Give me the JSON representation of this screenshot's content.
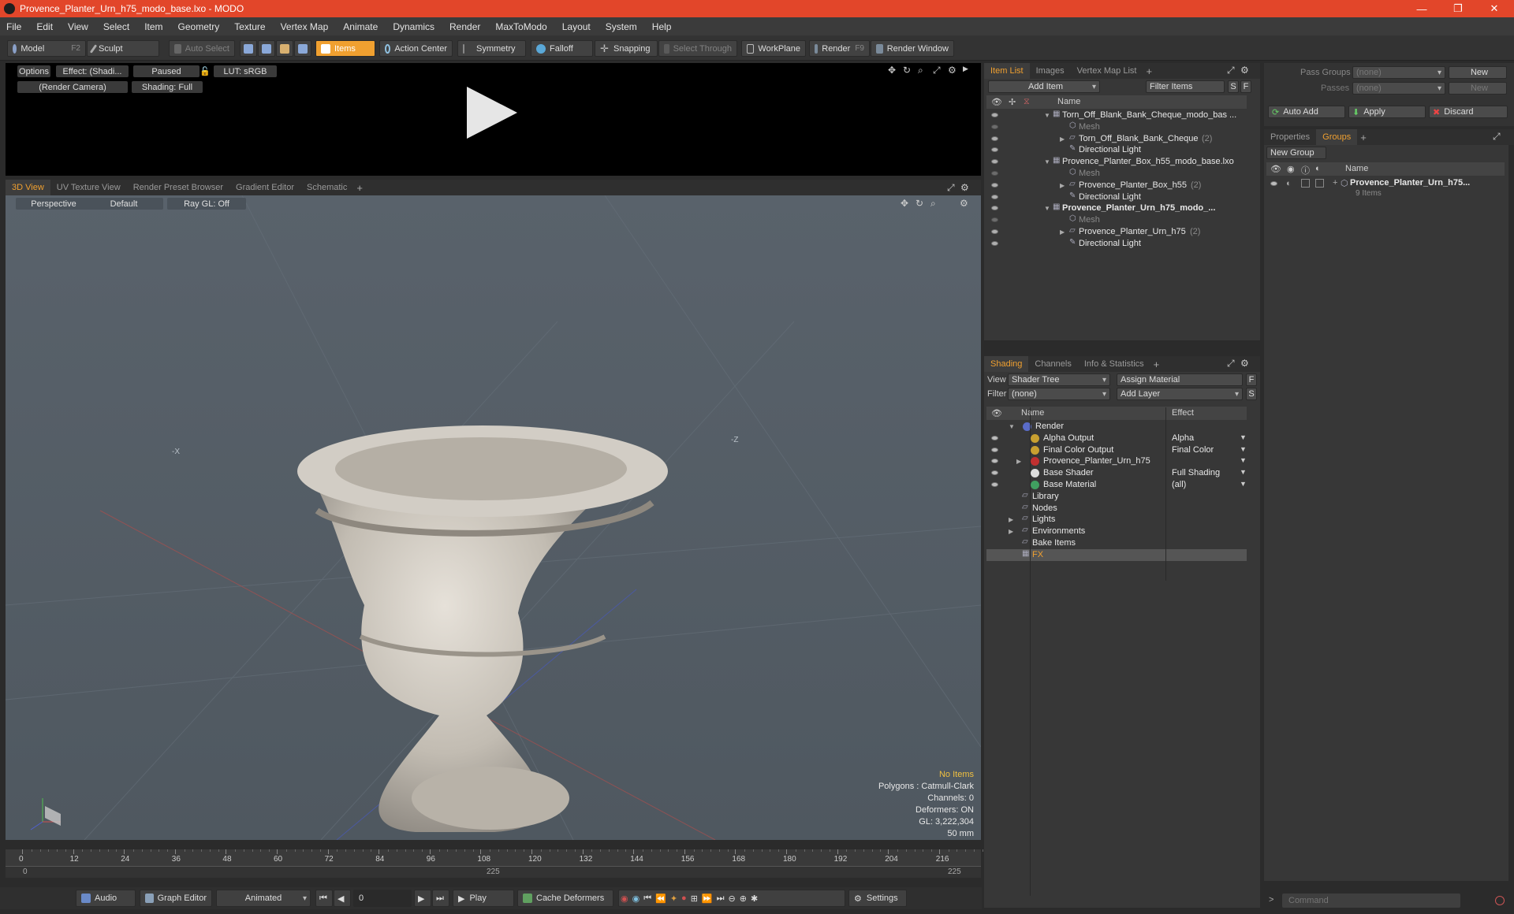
{
  "window": {
    "title": "Provence_Planter_Urn_h75_modo_base.lxo - MODO",
    "minimize": "—",
    "restore": "❐",
    "close": "✕"
  },
  "menu": [
    "File",
    "Edit",
    "View",
    "Select",
    "Item",
    "Geometry",
    "Texture",
    "Vertex Map",
    "Animate",
    "Dynamics",
    "Render",
    "MaxToModo",
    "Layout",
    "System",
    "Help"
  ],
  "toolbar": {
    "model": "Model",
    "model_key": "F2",
    "sculpt": "Sculpt",
    "auto_select": "Auto Select",
    "items": "Items",
    "action_center": "Action Center",
    "symmetry": "Symmetry",
    "falloff": "Falloff",
    "snapping": "Snapping",
    "select_through": "Select Through",
    "workplane": "WorkPlane",
    "render": "Render",
    "render_key": "F9",
    "render_window": "Render Window"
  },
  "preview": {
    "options": "Options",
    "effect": "Effect: (Shadi...",
    "paused": "Paused",
    "lut": "LUT: sRGB",
    "camera": "(Render Camera)",
    "shading": "Shading: Full"
  },
  "viewport_tabs": [
    "3D View",
    "UV Texture View",
    "Render Preset Browser",
    "Gradient Editor",
    "Schematic",
    "+"
  ],
  "viewport": {
    "projection": "Perspective",
    "style": "Default",
    "raygl": "Ray GL: Off",
    "axis_x": "-X",
    "axis_z": "-Z",
    "info": {
      "items": "No Items",
      "polygons": "Polygons : Catmull-Clark",
      "channels": "Channels: 0",
      "deformers": "Deformers: ON",
      "gl": "GL: 3,222,304",
      "size": "50 mm"
    }
  },
  "timeline": {
    "ticks": [
      "0",
      "12",
      "24",
      "36",
      "48",
      "60",
      "72",
      "84",
      "96",
      "108",
      "120",
      "132",
      "144",
      "156",
      "168",
      "180",
      "192",
      "204",
      "216"
    ],
    "start": "0",
    "mid": "225",
    "end": "225"
  },
  "bottom": {
    "audio": "Audio",
    "graph_editor": "Graph Editor",
    "animated": "Animated",
    "frame": "0",
    "play": "Play",
    "cache_deformers": "Cache Deformers",
    "settings": "Settings"
  },
  "item_list": {
    "tabs": [
      "Item List",
      "Images",
      "Vertex Map List",
      "+"
    ],
    "add_item": "Add Item",
    "filter_items": "Filter Items",
    "s": "S",
    "f": "F",
    "name_header": "Name",
    "rows": [
      {
        "label": "Torn_Off_Blank_Bank_Cheque_modo_bas ...",
        "count": "",
        "indent": 0,
        "type": "scene",
        "bold": false
      },
      {
        "label": "Mesh",
        "count": "",
        "indent": 1,
        "type": "mesh",
        "bold": false
      },
      {
        "label": "Torn_Off_Blank_Bank_Cheque",
        "count": "(2)",
        "indent": 1,
        "type": "group",
        "bold": false
      },
      {
        "label": "Directional Light",
        "count": "",
        "indent": 1,
        "type": "light",
        "bold": false
      },
      {
        "label": "Provence_Planter_Box_h55_modo_base.lxo",
        "count": "",
        "indent": 0,
        "type": "scene",
        "bold": false
      },
      {
        "label": "Mesh",
        "count": "",
        "indent": 1,
        "type": "mesh",
        "bold": false
      },
      {
        "label": "Provence_Planter_Box_h55",
        "count": "(2)",
        "indent": 1,
        "type": "group",
        "bold": false
      },
      {
        "label": "Directional Light",
        "count": "",
        "indent": 1,
        "type": "light",
        "bold": false
      },
      {
        "label": "Provence_Planter_Urn_h75_modo_...",
        "count": "",
        "indent": 0,
        "type": "scene",
        "bold": true
      },
      {
        "label": "Mesh",
        "count": "",
        "indent": 1,
        "type": "mesh",
        "bold": false
      },
      {
        "label": "Provence_Planter_Urn_h75",
        "count": "(2)",
        "indent": 1,
        "type": "group",
        "bold": false
      },
      {
        "label": "Directional Light",
        "count": "",
        "indent": 1,
        "type": "light",
        "bold": false
      }
    ]
  },
  "shading": {
    "tabs": [
      "Shading",
      "Channels",
      "Info & Statistics",
      "+"
    ],
    "view_label": "View",
    "view_value": "Shader Tree",
    "assign_material": "Assign Material",
    "filter_label": "Filter",
    "filter_value": "(none)",
    "add_layer": "Add Layer",
    "f": "F",
    "s": "S",
    "name_header": "Name",
    "effect_header": "Effect",
    "rows": [
      {
        "label": "Render",
        "effect": "",
        "indent": 0,
        "icon": "#5a6cc8",
        "eye": false,
        "fx": false
      },
      {
        "label": "Alpha Output",
        "effect": "Alpha",
        "indent": 1,
        "icon": "#c8a030",
        "eye": true,
        "fx": false
      },
      {
        "label": "Final Color Output",
        "effect": "Final Color",
        "indent": 1,
        "icon": "#c8a030",
        "eye": true,
        "fx": false
      },
      {
        "label": "Provence_Planter_Urn_h75",
        "effect": "",
        "indent": 1,
        "icon": "#c03030",
        "eye": true,
        "fx": false
      },
      {
        "label": "Base Shader",
        "effect": "Full Shading",
        "indent": 1,
        "icon": "#dddddd",
        "eye": true,
        "fx": false
      },
      {
        "label": "Base Material",
        "effect": "(all)",
        "indent": 1,
        "icon": "#40a060",
        "eye": true,
        "fx": false
      },
      {
        "label": "Library",
        "effect": "",
        "indent": 0,
        "icon": "",
        "eye": false,
        "fx": false
      },
      {
        "label": "Nodes",
        "effect": "",
        "indent": 0,
        "icon": "",
        "eye": false,
        "fx": false
      },
      {
        "label": "Lights",
        "effect": "",
        "indent": 0,
        "icon": "",
        "eye": false,
        "fx": false
      },
      {
        "label": "Environments",
        "effect": "",
        "indent": 0,
        "icon": "",
        "eye": false,
        "fx": false
      },
      {
        "label": "Bake Items",
        "effect": "",
        "indent": 0,
        "icon": "",
        "eye": false,
        "fx": false
      },
      {
        "label": "FX",
        "effect": "",
        "indent": 0,
        "icon": "",
        "eye": false,
        "fx": true
      }
    ]
  },
  "groups_panel": {
    "pass_groups": "Pass Groups",
    "passes": "Passes",
    "none": "(none)",
    "new": "New",
    "auto_add": "Auto Add",
    "apply": "Apply",
    "discard": "Discard",
    "tabs": [
      "Properties",
      "Groups",
      "+"
    ],
    "new_group": "New Group",
    "name_header": "Name",
    "group_name": "Provence_Planter_Urn_h75...",
    "group_items": "9 Items"
  },
  "command": {
    "placeholder": "Command",
    "prompt": ">"
  }
}
